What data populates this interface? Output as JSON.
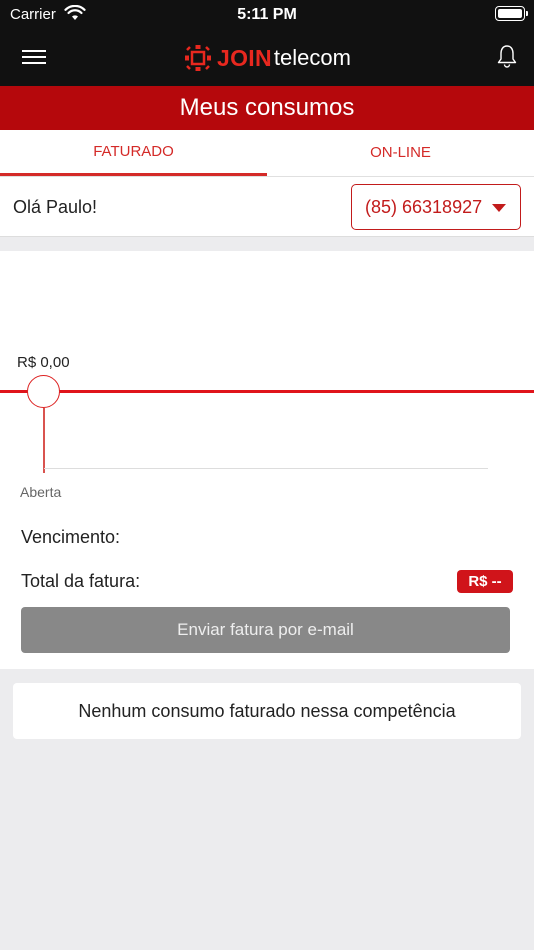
{
  "status_bar": {
    "carrier": "Carrier",
    "time": "5:11 PM"
  },
  "navbar": {
    "logo_brand": "JOIN",
    "logo_suffix": "telecom"
  },
  "header": {
    "title": "Meus consumos"
  },
  "tabs": [
    {
      "label": "FATURADO",
      "active": true
    },
    {
      "label": "ON-LINE",
      "active": false
    }
  ],
  "greeting": {
    "text": "Olá Paulo!"
  },
  "phone_select": {
    "selected": "(85) 66318927"
  },
  "invoice": {
    "amount": "R$ 0,00",
    "status": "Aberta",
    "due_label": "Vencimento:",
    "total_label": "Total da fatura:",
    "total_value": "R$ --",
    "email_button": "Enviar fatura por e-mail"
  },
  "notice": {
    "text": "Nenhum consumo faturado nessa competência"
  },
  "colors": {
    "brand_red": "#b5080c",
    "accent_red": "#e0141b",
    "navbar_bg": "#111111",
    "disabled_button": "#888888"
  }
}
